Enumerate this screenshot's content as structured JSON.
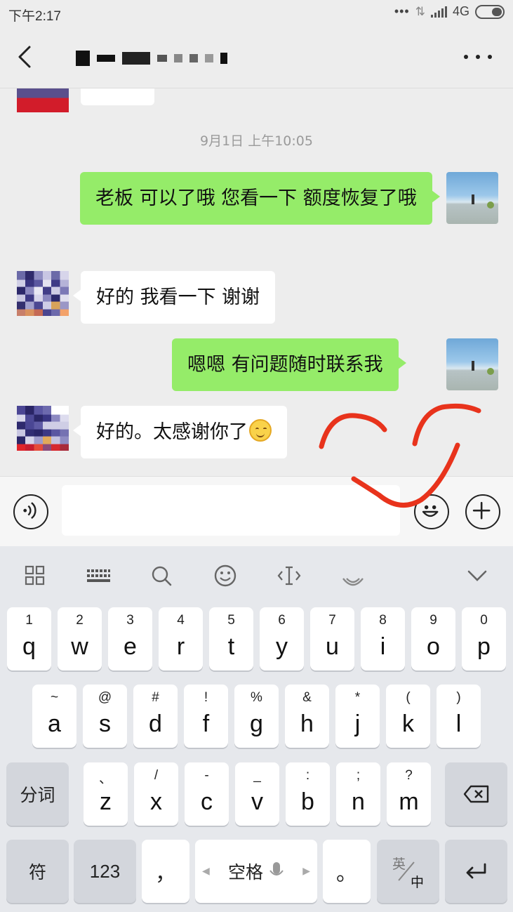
{
  "status_bar": {
    "time": "下午2:17",
    "network": "4G"
  },
  "chat": {
    "timestamp": "9月1日 上午10:05",
    "messages": [
      {
        "side": "right",
        "text": "老板  可以了哦  您看一下 额度恢复了哦"
      },
      {
        "side": "left",
        "text": "好的 我看一下  谢谢"
      },
      {
        "side": "right",
        "text": "嗯嗯 有问题随时联系我"
      },
      {
        "side": "left",
        "text": "好的。太感谢你了"
      }
    ]
  },
  "input": {
    "placeholder": ""
  },
  "keyboard": {
    "row1": [
      {
        "sup": "1",
        "key": "q"
      },
      {
        "sup": "2",
        "key": "w"
      },
      {
        "sup": "3",
        "key": "e"
      },
      {
        "sup": "4",
        "key": "r"
      },
      {
        "sup": "5",
        "key": "t"
      },
      {
        "sup": "6",
        "key": "y"
      },
      {
        "sup": "7",
        "key": "u"
      },
      {
        "sup": "8",
        "key": "i"
      },
      {
        "sup": "9",
        "key": "o"
      },
      {
        "sup": "0",
        "key": "p"
      }
    ],
    "row2": [
      {
        "sup": "~",
        "key": "a"
      },
      {
        "sup": "@",
        "key": "s"
      },
      {
        "sup": "#",
        "key": "d"
      },
      {
        "sup": "!",
        "key": "f"
      },
      {
        "sup": "%",
        "key": "g"
      },
      {
        "sup": "&",
        "key": "h"
      },
      {
        "sup": "*",
        "key": "j"
      },
      {
        "sup": "(",
        "key": "k"
      },
      {
        "sup": ")",
        "key": "l"
      }
    ],
    "row3": [
      {
        "sup": "、",
        "key": "z"
      },
      {
        "sup": "/",
        "key": "x"
      },
      {
        "sup": "-",
        "key": "c"
      },
      {
        "sup": "_",
        "key": "v"
      },
      {
        "sup": ":",
        "key": "b"
      },
      {
        "sup": ";",
        "key": "n"
      },
      {
        "sup": "?",
        "key": "m"
      }
    ],
    "segment_label": "分词",
    "symbols_label": "符",
    "numbers_label": "123",
    "comma_label": "，",
    "space_label": "空格",
    "period_label": "。",
    "lang_top": "英",
    "lang_bottom": "中"
  },
  "colors": {
    "sent_bubble": "#95ec69",
    "received_bubble": "#ffffff",
    "annotation": "#e8331c"
  }
}
